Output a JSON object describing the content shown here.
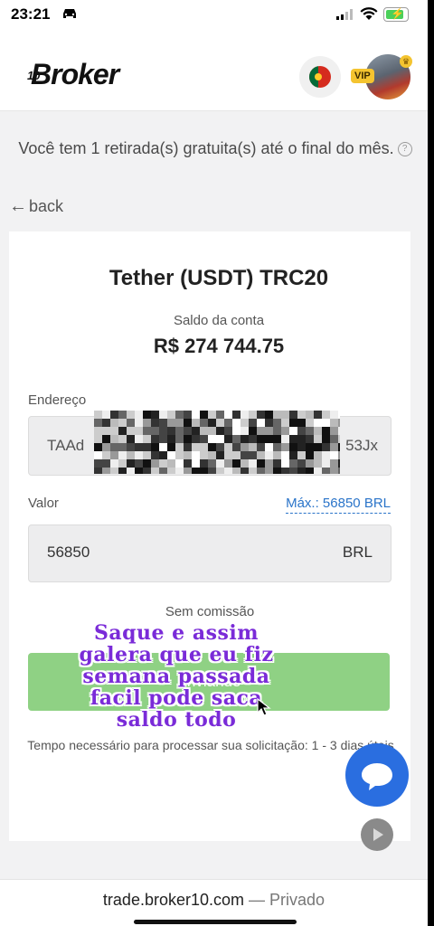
{
  "status_bar": {
    "time": "23:21"
  },
  "header": {
    "logo_number": "10",
    "logo_text": "Broker",
    "vip_badge": "VIP"
  },
  "notice": {
    "text": "Você tem 1 retirada(s) gratuita(s) até o final do mês.",
    "help_glyph": "?"
  },
  "nav": {
    "back_label": "back"
  },
  "withdraw": {
    "coin_title": "Tether (USDT) TRC20",
    "balance_label": "Saldo da conta",
    "balance_value": "R$ 274 744.75",
    "address_label": "Endereço",
    "address_start": "TAAd",
    "address_end": "53Jx",
    "amount_label": "Valor",
    "max_link": "Máx.: 56850 BRL",
    "amount_value": "56850",
    "amount_currency": "BRL",
    "fee_text": "Sem comissão",
    "submit_label": "Enviando",
    "processing_text": "Tempo necessário para processar sua solicitação: 1 - 3 dias úteis"
  },
  "overlay_caption": {
    "lines": [
      "Saque e assim",
      "galera que eu fiz",
      "semana passada",
      "facil pode saca",
      "saldo todo"
    ],
    "color": "#7a2bd8"
  },
  "browser_bar": {
    "domain": "trade.broker10.com",
    "separator": "—",
    "mode": "Privado"
  },
  "colors": {
    "accent_blue": "#2a74c9",
    "submit_green": "#8fd184",
    "chat_blue": "#2a6ee0"
  },
  "icons": [
    "car-icon",
    "signal-icon",
    "wifi-icon",
    "battery-icon",
    "flag-portugal-icon",
    "crown-icon",
    "help-icon",
    "back-arrow-icon",
    "chat-icon",
    "play-icon",
    "cursor-icon"
  ]
}
